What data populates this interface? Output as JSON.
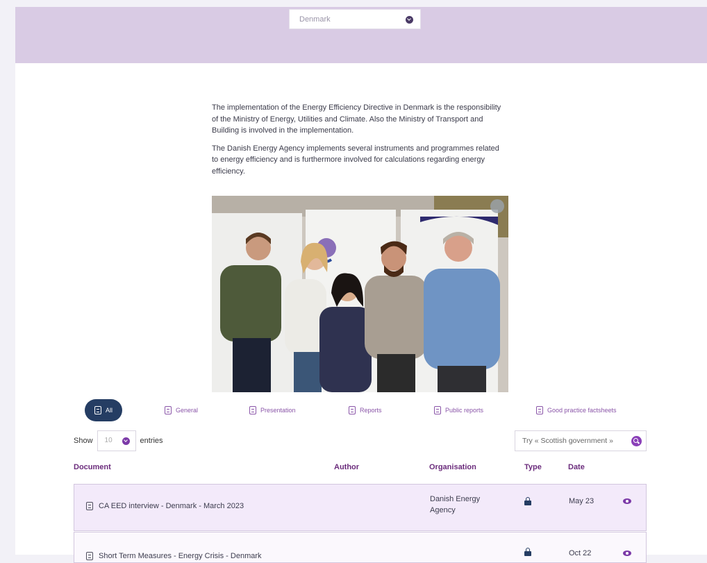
{
  "country_select": {
    "value": "Denmark"
  },
  "intro": {
    "p1": "The implementation of the Energy Efficiency Directive in Denmark is the responsibility of the Ministry of Energy, Utilities and Climate. Also the Ministry of Transport and Building is involved in the implementation.",
    "p2": "The Danish Energy Agency implements several instruments and programmes related to energy efficiency and is furthermore involved for calculations regarding energy efficiency."
  },
  "filters": [
    "All",
    "General",
    "Presentation",
    "Reports",
    "Public reports",
    "Good practice factsheets"
  ],
  "table_controls": {
    "show": "Show",
    "entries_value": "10",
    "entries": "entries",
    "search_placeholder": "Try « Scottish government »"
  },
  "table": {
    "headers": [
      "Document",
      "Author",
      "Organisation",
      "Type",
      "Date"
    ],
    "rows": [
      {
        "document": "CA EED interview - Denmark - March 2023",
        "author": "",
        "organisation": "Danish Energy Agency",
        "type_icon": "lock-icon",
        "date": "May 23",
        "action_icon": "eye-icon"
      },
      {
        "document": "Short Term Measures - Energy Crisis - Denmark",
        "author": "",
        "organisation": "",
        "type_icon": "lock-icon",
        "date": "Oct 22",
        "action_icon": "eye-icon"
      }
    ]
  },
  "colors": {
    "banner": "#d9cbe4",
    "accent": "#7c3aa8",
    "header_text": "#6b2c7c",
    "active_filter": "#253d63"
  }
}
